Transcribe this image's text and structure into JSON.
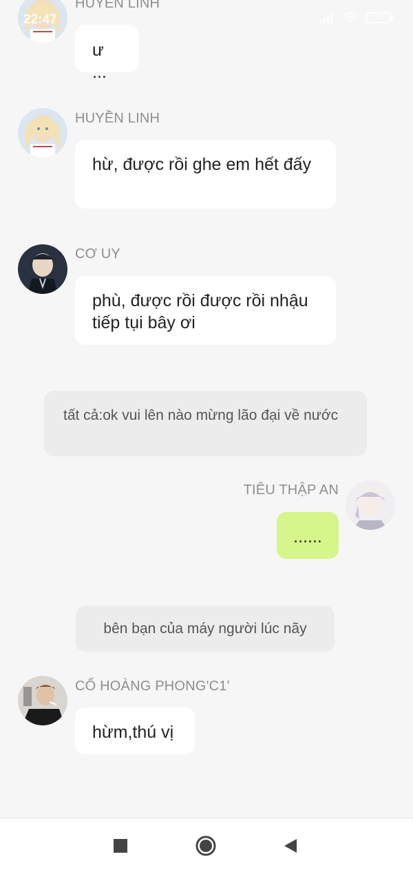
{
  "status_bar": {
    "time": "22:47",
    "battery": "84"
  },
  "messages": [
    {
      "type": "left",
      "sender": "HUYỀN LINH",
      "text": "ư ...",
      "avatar": "anime-girl-blonde-avatar"
    },
    {
      "type": "left",
      "sender": "HUYỀN LINH",
      "text": "hừ, được rồi ghe em hết đấy",
      "avatar": "anime-girl-blonde-avatar"
    },
    {
      "type": "left",
      "sender": "CƠ UY",
      "text": "phù, được rồi được rồi nhậu tiếp tụi bây ơi",
      "avatar": "anime-boy-dark-avatar"
    },
    {
      "type": "narration",
      "text": "tất cả:ok vui lên nào mừng lão đại về nước"
    },
    {
      "type": "right",
      "sender": "TIÊU THẬP AN",
      "text": "......",
      "avatar": "anime-boy-white-hair-avatar"
    },
    {
      "type": "narration",
      "text": "bên bạn của máy người lúc nãy"
    },
    {
      "type": "left",
      "sender": "CỐ HOÀNG PHONG'C1'",
      "text": "hừm,thú vị",
      "avatar": "man-smoking-avatar"
    }
  ],
  "nav": {
    "recent": "square-icon",
    "home": "circle-icon",
    "back": "triangle-back-icon"
  },
  "colors": {
    "background": "#f6f6f6",
    "bubble": "#ffffff",
    "bubble_self": "#d6f58a",
    "narration": "#ececec",
    "sender": "#8e8e8e"
  }
}
